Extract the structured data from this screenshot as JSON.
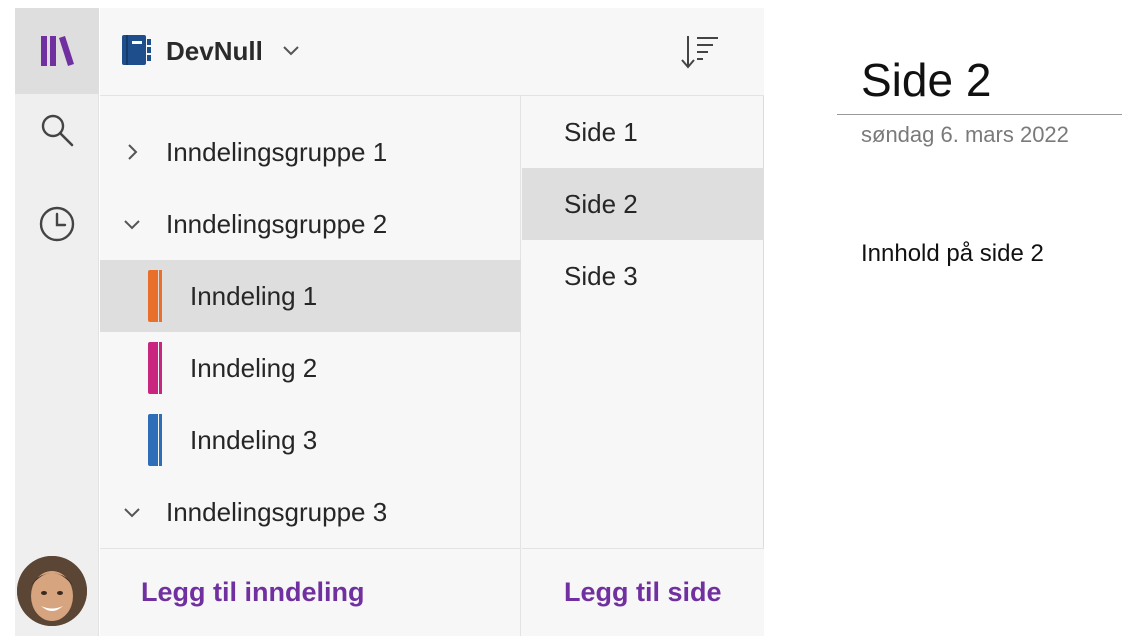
{
  "notebook": {
    "name": "DevNull"
  },
  "section_groups": [
    {
      "label": "Inndelingsgruppe 1",
      "expanded": false
    },
    {
      "label": "Inndelingsgruppe 2",
      "expanded": true
    },
    {
      "label": "Inndelingsgruppe 3",
      "expanded": true
    }
  ],
  "sections": [
    {
      "label": "Inndeling 1",
      "color": "#e8702a",
      "selected": true
    },
    {
      "label": "Inndeling 2",
      "color": "#c8267f",
      "selected": false
    },
    {
      "label": "Inndeling 3",
      "color": "#2e6db8",
      "selected": false
    }
  ],
  "pages": [
    {
      "label": "Side 1",
      "selected": false
    },
    {
      "label": "Side 2",
      "selected": true
    },
    {
      "label": "Side 3",
      "selected": false
    }
  ],
  "footer": {
    "add_section": "Legg til inndeling",
    "add_page": "Legg til side"
  },
  "page": {
    "title": "Side 2",
    "date": "søndag 6. mars 2022",
    "body": "Innhold på side 2"
  },
  "colors": {
    "accent": "#7030a0",
    "notebook_icon": "#1f4e8c",
    "selected_bg": "#dedede"
  },
  "icons": {
    "rail": [
      "notebooks-icon",
      "search-icon",
      "recent-icon"
    ],
    "sort": "sort-icon"
  }
}
